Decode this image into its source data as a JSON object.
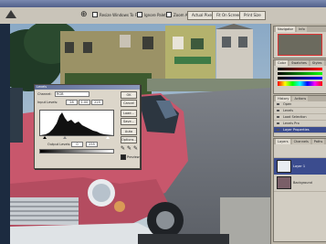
{
  "options_bar": {
    "sample_all_layers": "Resize Windows To Fit",
    "ignore_palettes": "Ignore Palettes",
    "zoom_all": "Zoom All",
    "actual_pixels": "Actual Pixels",
    "fit_on_screen": "Fit On Screen",
    "print_size": "Print Size"
  },
  "levels_dialog": {
    "title": "Levels",
    "channel_label": "Channel:",
    "channel_value": "RGB",
    "input_label": "Input Levels:",
    "input_black": "28",
    "input_gamma": "1.00",
    "input_white": "225",
    "output_label": "Output Levels:",
    "output_black": "0",
    "output_white": "255",
    "buttons": [
      "OK",
      "Cancel",
      "Load...",
      "Save...",
      "Auto",
      "Options..."
    ],
    "preview_label": "Preview"
  },
  "palettes": {
    "navigator_tabs": [
      "Navigator",
      "Info"
    ],
    "color_tabs": [
      "Color",
      "Swatches",
      "Styles"
    ],
    "history_tabs": [
      "History",
      "Actions"
    ],
    "history_items": [
      "Open",
      "Levels",
      "Load Selection",
      "Levels Pro",
      "Layer Properties"
    ],
    "layers_tabs": [
      "Layers",
      "Channels",
      "Paths"
    ],
    "layer_names": [
      "Layer 1",
      "Background"
    ]
  },
  "colors": {
    "accent": "#3b4c8e",
    "car_red": "#c8576c"
  }
}
